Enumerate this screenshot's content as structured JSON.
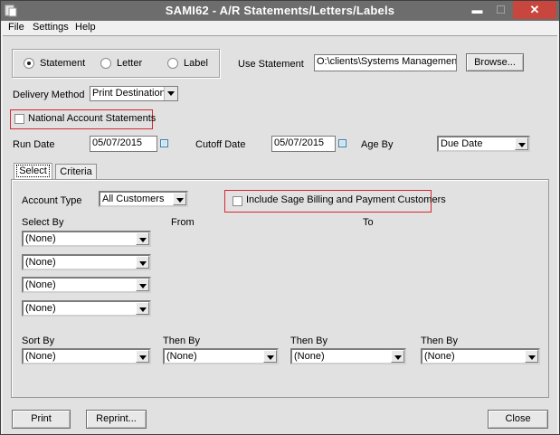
{
  "window": {
    "title": "SAMI62 - A/R Statements/Letters/Labels"
  },
  "menu": {
    "file": "File",
    "settings": "Settings",
    "help": "Help"
  },
  "mode": {
    "statement": "Statement",
    "letter": "Letter",
    "label": "Label",
    "selected": "statement"
  },
  "use_statement": {
    "label": "Use Statement",
    "value": "O:\\clients\\Systems Management\\",
    "browse": "Browse..."
  },
  "delivery": {
    "label": "Delivery Method",
    "value": "Print Destination"
  },
  "national": {
    "label": "National Account Statements",
    "checked": false
  },
  "run_date": {
    "label": "Run Date",
    "value": "05/07/2015"
  },
  "cutoff_date": {
    "label": "Cutoff Date",
    "value": "05/07/2015"
  },
  "age_by": {
    "label": "Age By",
    "value": "Due Date"
  },
  "tabs": {
    "select": "Select",
    "criteria": "Criteria"
  },
  "select_tab": {
    "account_type_label": "Account Type",
    "account_type_value": "All Customers",
    "sage_label": "Include Sage Billing and Payment Customers",
    "select_by_label": "Select By",
    "from_label": "From",
    "to_label": "To",
    "select_by": [
      "(None)",
      "(None)",
      "(None)",
      "(None)"
    ],
    "sort_by_label": "Sort By",
    "sort_by_value": "(None)",
    "then_by": [
      {
        "label": "Then By",
        "value": "(None)"
      },
      {
        "label": "Then By",
        "value": "(None)"
      },
      {
        "label": "Then By",
        "value": "(None)"
      }
    ]
  },
  "footer": {
    "print": "Print",
    "reprint": "Reprint...",
    "close": "Close"
  },
  "colors": {
    "titlebar": "#6d6d6d",
    "close": "#c7463d",
    "highlight": "#d9262e"
  }
}
